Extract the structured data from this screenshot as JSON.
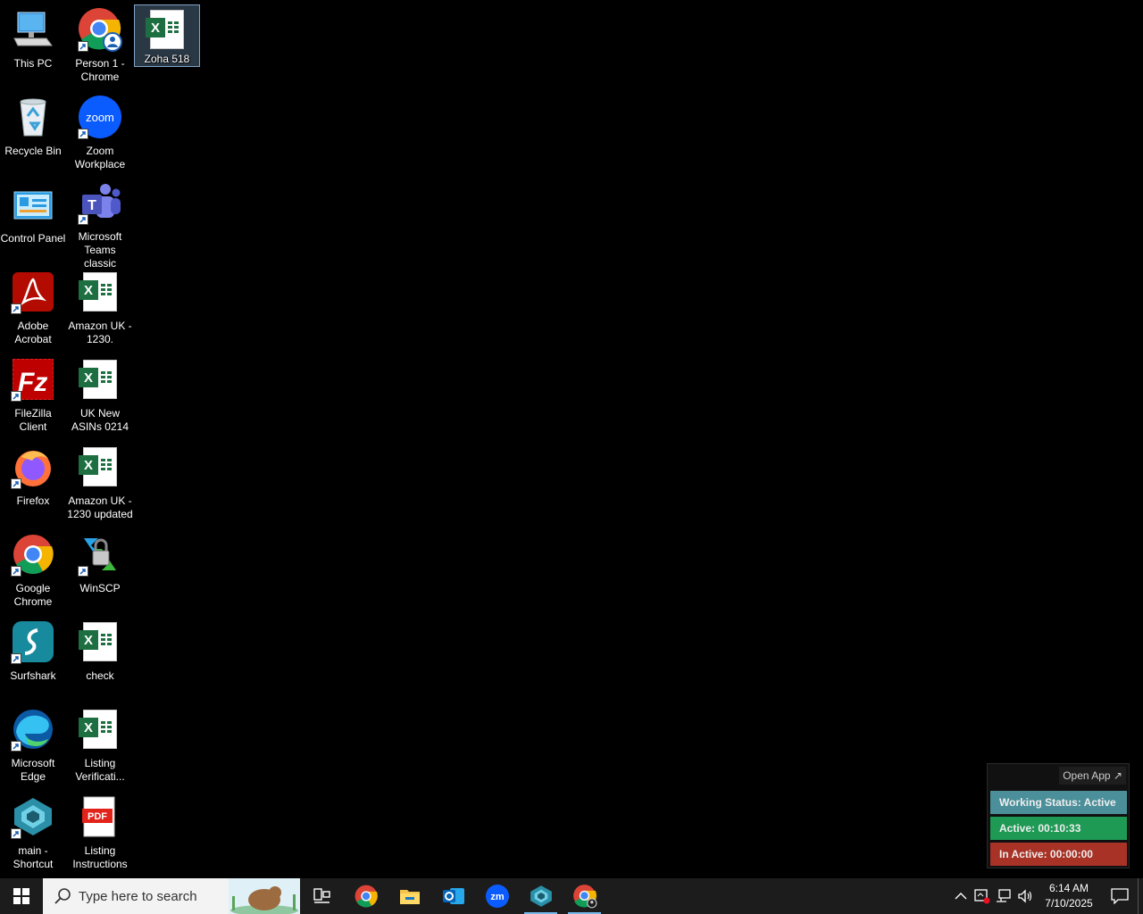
{
  "desktop": {
    "icons": [
      {
        "label": "This PC",
        "icon": "this-pc-icon"
      },
      {
        "label": "Person 1 - Chrome",
        "icon": "chrome-profile-icon"
      },
      {
        "label": "Zoha 518",
        "icon": "excel-file-icon",
        "selected": true
      },
      {
        "label": "Recycle Bin",
        "icon": "recycle-bin-icon"
      },
      {
        "label": "Zoom Workplace",
        "icon": "zoom-icon"
      },
      {
        "label": "Control Panel",
        "icon": "control-panel-icon"
      },
      {
        "label": "Microsoft Teams classic",
        "icon": "teams-icon"
      },
      {
        "label": "Adobe Acrobat",
        "icon": "acrobat-icon"
      },
      {
        "label": "Amazon UK - 1230.",
        "icon": "excel-file-icon"
      },
      {
        "label": "FileZilla Client",
        "icon": "filezilla-icon"
      },
      {
        "label": "UK New ASINs 0214",
        "icon": "excel-file-icon"
      },
      {
        "label": "Firefox",
        "icon": "firefox-icon"
      },
      {
        "label": "Amazon UK - 1230 updated",
        "icon": "excel-file-icon"
      },
      {
        "label": "Google Chrome",
        "icon": "chrome-icon"
      },
      {
        "label": "WinSCP",
        "icon": "winscp-icon"
      },
      {
        "label": "Surfshark",
        "icon": "surfshark-icon"
      },
      {
        "label": "check",
        "icon": "excel-file-icon"
      },
      {
        "label": "Microsoft Edge",
        "icon": "edge-icon"
      },
      {
        "label": "Listing Verificati...",
        "icon": "excel-file-icon"
      },
      {
        "label": "main - Shortcut",
        "icon": "main-app-icon"
      },
      {
        "label": "Listing Instructions",
        "icon": "pdf-file-icon"
      }
    ]
  },
  "taskbar": {
    "search_placeholder": "Type here to search",
    "pinned": [
      "task-view-icon",
      "chrome-icon",
      "file-explorer-icon",
      "outlook-icon",
      "zoom-icon",
      "main-app-icon",
      "chrome-profile-icon"
    ],
    "clock_time": "6:14 AM",
    "clock_date": "7/10/2025"
  },
  "widget": {
    "open_app": "Open App ↗",
    "working_status": "Working Status: Active",
    "active": "Active: 00:10:33",
    "inactive": "In Active: 00:00:00"
  }
}
